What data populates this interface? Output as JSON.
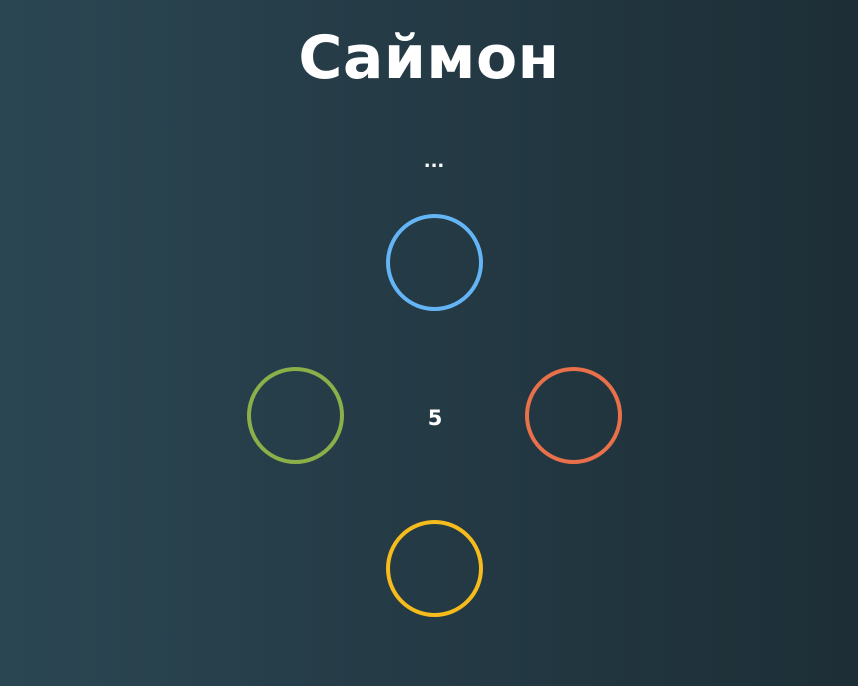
{
  "game": {
    "title": "Саймон",
    "status_text": "...",
    "counter": "5"
  },
  "pads": {
    "blue": {
      "color": "#64b5f6"
    },
    "green": {
      "color": "#8bb04a"
    },
    "orange": {
      "color": "#e8704a"
    },
    "yellow": {
      "color": "#f5bc1c"
    }
  },
  "background": {
    "gradient_left": "#2b4653",
    "gradient_right": "#1d2e36"
  }
}
